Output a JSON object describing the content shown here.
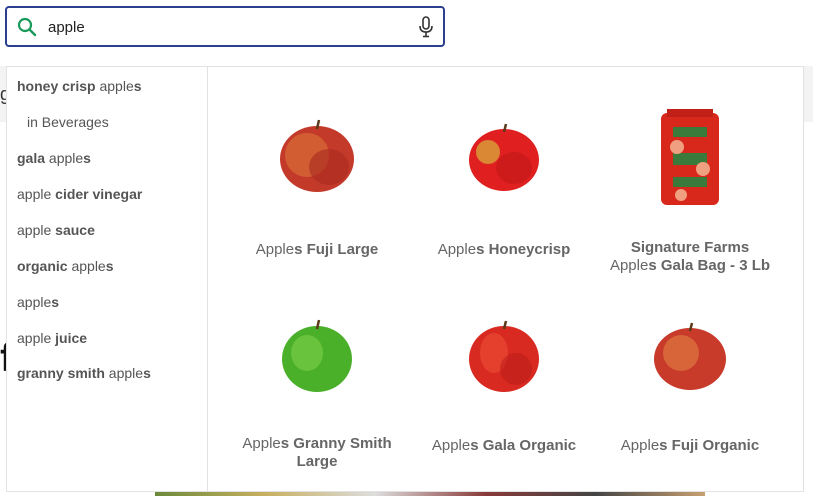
{
  "search": {
    "value": "apple",
    "placeholder": ""
  },
  "background": {
    "glyph_g": "g",
    "glyph_f": "f"
  },
  "suggestions": [
    {
      "pre": "",
      "bold": "honey crisp",
      "mid": " apple",
      "tail": "s"
    },
    {
      "pre": "in Beverages",
      "bold": "",
      "mid": "",
      "tail": ""
    },
    {
      "pre": "",
      "bold": "gala",
      "mid": " apple",
      "tail": "s"
    },
    {
      "pre": "apple ",
      "bold": "cider vinegar",
      "mid": "",
      "tail": ""
    },
    {
      "pre": "apple ",
      "bold": "sauce",
      "mid": "",
      "tail": ""
    },
    {
      "pre": "",
      "bold": "organic",
      "mid": " apple",
      "tail": "s"
    },
    {
      "pre": "apple",
      "bold": "",
      "mid": "",
      "tail": "s"
    },
    {
      "pre": "apple ",
      "bold": "juice",
      "mid": "",
      "tail": ""
    },
    {
      "pre": "",
      "bold": "granny smith",
      "mid": " apple",
      "tail": "s"
    }
  ],
  "products": [
    {
      "line1_pre": "",
      "line1_bold": "",
      "pre": "Apple",
      "bold": "s Fuji Large",
      "image": "red-apple-fuji"
    },
    {
      "line1_pre": "",
      "line1_bold": "",
      "pre": "Apple",
      "bold": "s Honeycrisp",
      "image": "red-apple-honeycrisp"
    },
    {
      "line1_pre": "",
      "line1_bold": "Signature Farms",
      "pre": "Apple",
      "bold": "s Gala Bag - 3 Lb",
      "image": "apple-bag"
    },
    {
      "line1_pre": "",
      "line1_bold": "",
      "pre": "Apple",
      "bold": "s Granny Smith Large",
      "image": "green-apple"
    },
    {
      "line1_pre": "",
      "line1_bold": "",
      "pre": "Apple",
      "bold": "s Gala Organic",
      "image": "red-apple-gala"
    },
    {
      "line1_pre": "",
      "line1_bold": "",
      "pre": "Apple",
      "bold": "s Fuji Organic",
      "image": "red-apple-fuji-organic"
    }
  ],
  "colors": {
    "search_border": "#2b3f8f",
    "search_icon": "#1a9a5a",
    "text": "#555555"
  }
}
